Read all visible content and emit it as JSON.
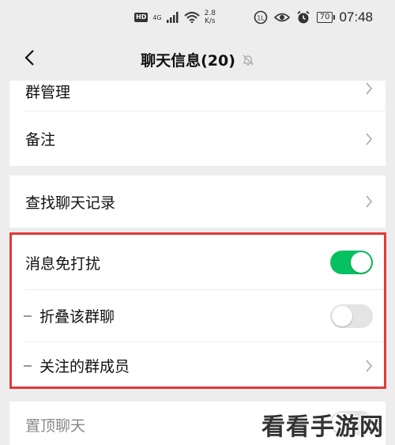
{
  "status_bar": {
    "hd": "HD",
    "network": "4G",
    "speed_value": "2.8",
    "speed_unit": "K/s",
    "battery": "70",
    "time": "07:48"
  },
  "nav": {
    "title": "聊天信息(20)",
    "back_icon": "chevron-left-icon",
    "mute_icon": "bell-off-icon"
  },
  "settings": {
    "group_manage": "群管理",
    "remark": "备注",
    "search_history": "查找聊天记录",
    "do_not_disturb": {
      "label": "消息免打扰",
      "on": true
    },
    "fold_group": {
      "label": "折叠该群聊",
      "on": false
    },
    "followed_members": "关注的群成员",
    "pin_chat": {
      "label": "置顶聊天",
      "on": false
    }
  },
  "colors": {
    "toggle_on": "#07c160",
    "toggle_off": "#e4e4e4",
    "highlight_border": "#e03a3a",
    "background": "#ededed"
  },
  "watermark": "看看手游网"
}
